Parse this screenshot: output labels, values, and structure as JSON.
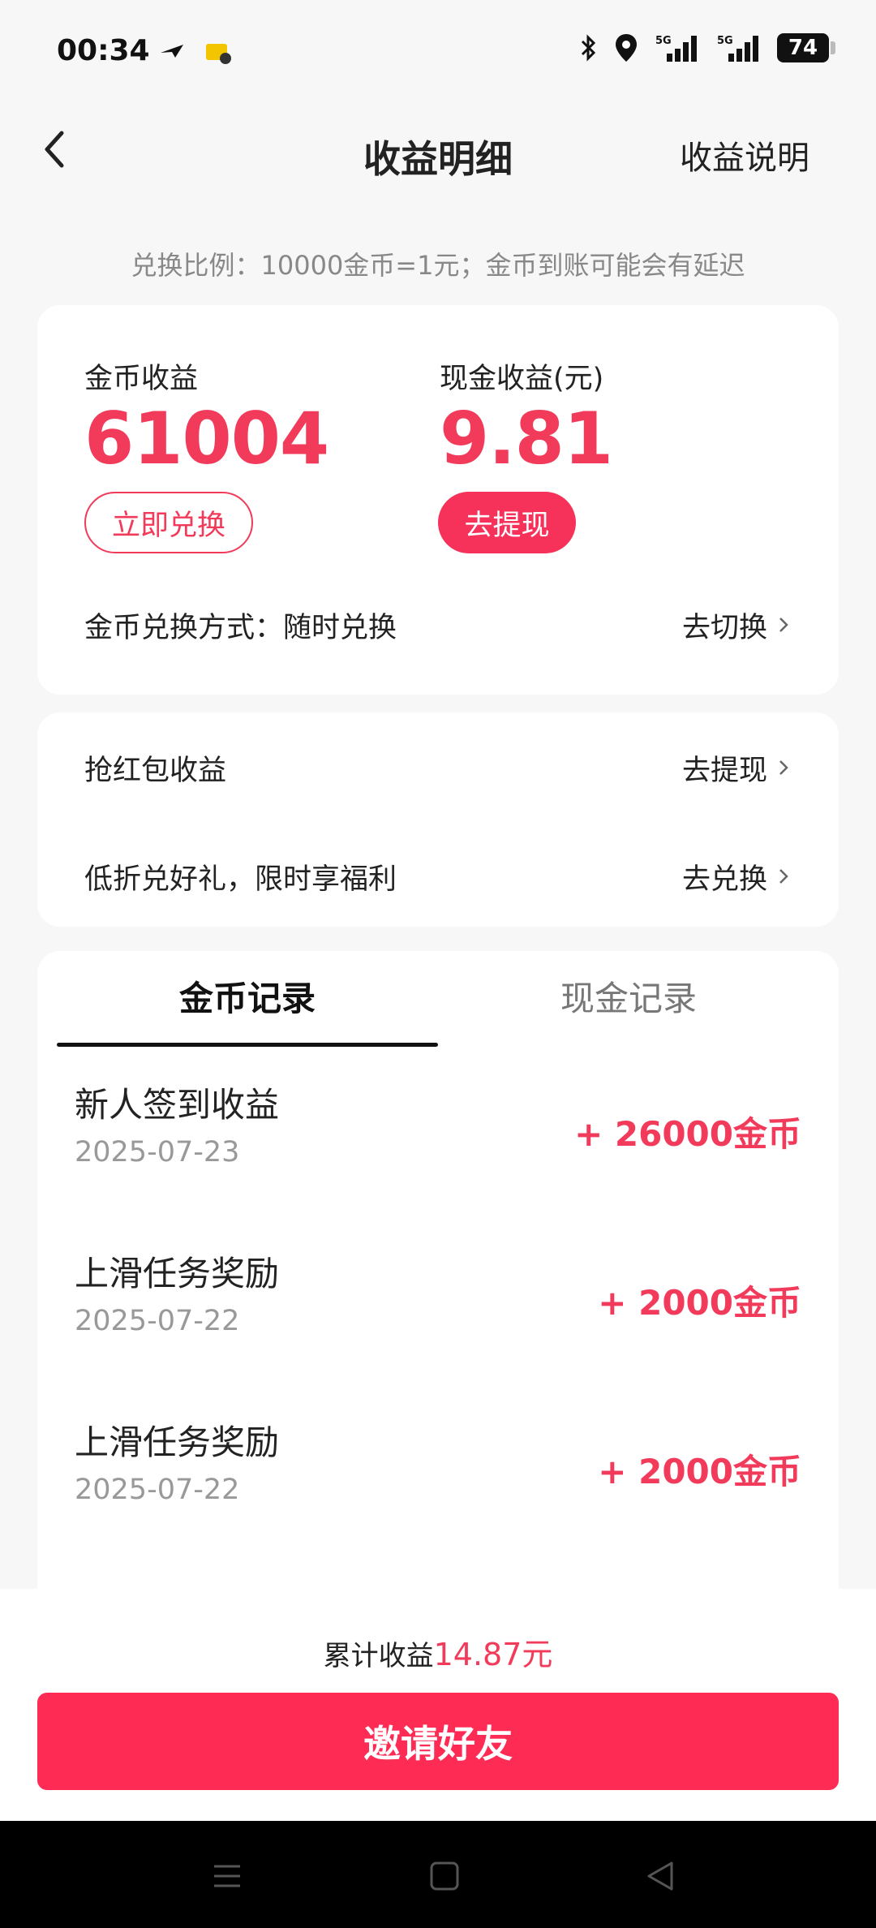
{
  "status_bar": {
    "time": "00:34",
    "battery": "74",
    "icons": [
      "airplane-like-icon",
      "app-notification-icon",
      "bluetooth-icon",
      "location-icon",
      "signal-5g-icon",
      "signal-5g-icon"
    ],
    "network1": "5G",
    "network2": "5G"
  },
  "header": {
    "title": "收益明细",
    "right_link": "收益说明"
  },
  "rate_note": "兑换比例：10000金币=1元；金币到账可能会有延迟",
  "earnings": {
    "coins_label": "金币收益",
    "coins_value": "61004",
    "cash_label": "现金收益(元)",
    "cash_value": "9.81",
    "exchange_button": "立即兑换",
    "withdraw_button": "去提现",
    "exchange_mode_label": "金币兑换方式：随时兑换",
    "exchange_mode_action": "去切换"
  },
  "links": {
    "red_packet_label": "抢红包收益",
    "red_packet_action": "去提现",
    "discount_label": "低折兑好礼，限时享福利",
    "discount_action": "去兑换"
  },
  "records": {
    "tabs": [
      "金币记录",
      "现金记录"
    ],
    "items": [
      {
        "title": "新人签到收益",
        "date": "2025-07-23",
        "amount": "+ 26000金币"
      },
      {
        "title": "上滑任务奖励",
        "date": "2025-07-22",
        "amount": "+ 2000金币"
      },
      {
        "title": "上滑任务奖励",
        "date": "2025-07-22",
        "amount": "+ 2000金币"
      }
    ]
  },
  "bottom": {
    "total_label": "累计收益",
    "total_amount": "14.87元",
    "invite_button": "邀请好友"
  },
  "colors": {
    "accent": "#f23a5a",
    "button": "#fe2c55"
  }
}
